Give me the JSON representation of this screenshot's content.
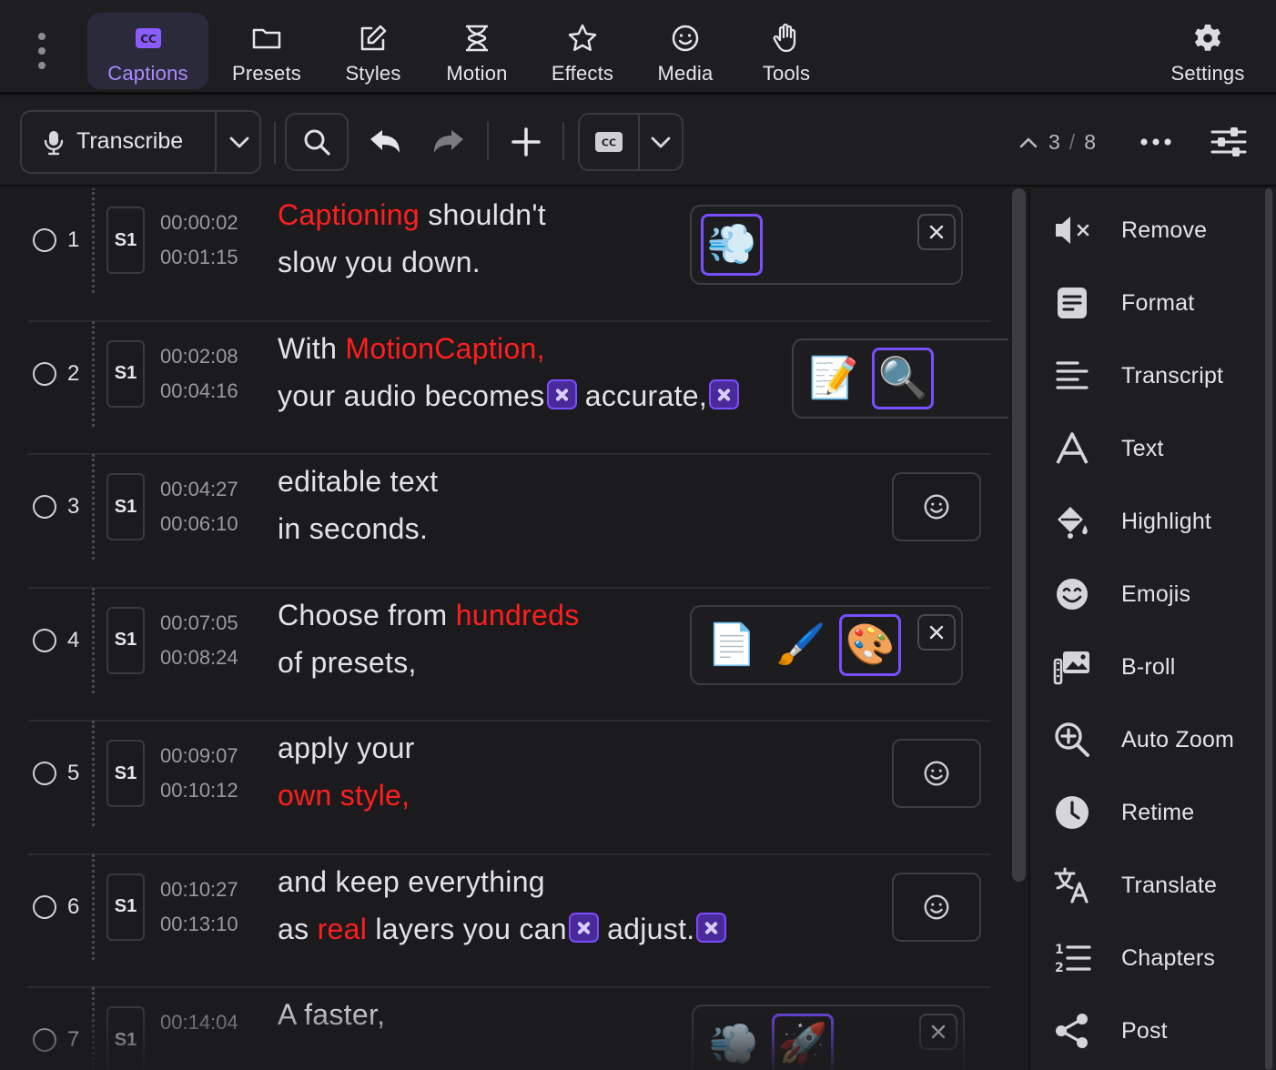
{
  "nav": {
    "items": [
      {
        "label": "Captions",
        "active": true
      },
      {
        "label": "Presets"
      },
      {
        "label": "Styles"
      },
      {
        "label": "Motion"
      },
      {
        "label": "Effects"
      },
      {
        "label": "Media"
      },
      {
        "label": "Tools"
      }
    ],
    "settings_label": "Settings",
    "captions_icon_text": "CC"
  },
  "toolbar": {
    "transcribe_label": "Transcribe",
    "cc_icon_text": "CC",
    "pager": {
      "current": "3",
      "separator": "/",
      "total": "8"
    }
  },
  "captions": [
    {
      "num": "1",
      "speaker": "S1",
      "start": "00:00:02",
      "end": "00:01:15",
      "line1": [
        {
          "t": "Captioning",
          "hl": true
        },
        {
          "t": " shouldn't"
        }
      ],
      "line2": [
        {
          "t": "slow you down."
        }
      ]
    },
    {
      "num": "2",
      "speaker": "S1",
      "start": "00:02:08",
      "end": "00:04:16",
      "line1": [
        {
          "t": "With "
        },
        {
          "t": "MotionCaption,",
          "hl": true
        }
      ],
      "line2": [
        {
          "t": "your audio becomes"
        },
        {
          "tag": true
        },
        {
          "t": " accurate,"
        },
        {
          "tag": true
        }
      ]
    },
    {
      "num": "3",
      "speaker": "S1",
      "start": "00:04:27",
      "end": "00:06:10",
      "line1": [
        {
          "t": "editable text"
        }
      ],
      "line2": [
        {
          "t": "in seconds."
        }
      ]
    },
    {
      "num": "4",
      "speaker": "S1",
      "start": "00:07:05",
      "end": "00:08:24",
      "line1": [
        {
          "t": "Choose from "
        },
        {
          "t": "hundreds",
          "hl": true
        }
      ],
      "line2": [
        {
          "t": "of presets,"
        }
      ]
    },
    {
      "num": "5",
      "speaker": "S1",
      "start": "00:09:07",
      "end": "00:10:12",
      "line1": [
        {
          "t": "apply your"
        }
      ],
      "line2": [
        {
          "t": "own style,",
          "hl": true
        }
      ]
    },
    {
      "num": "6",
      "speaker": "S1",
      "start": "00:10:27",
      "end": "00:13:10",
      "line1": [
        {
          "t": "and keep everything"
        }
      ],
      "line2": [
        {
          "t": "as "
        },
        {
          "t": "real",
          "hl": true
        },
        {
          "t": " layers you can"
        },
        {
          "tag": true
        },
        {
          "t": " adjust."
        },
        {
          "tag": true
        }
      ]
    },
    {
      "num": "7",
      "speaker": "S1",
      "start": "00:14:04",
      "end": "",
      "line1": [
        {
          "t": "A faster,"
        }
      ],
      "line2": []
    }
  ],
  "effects": {
    "row1": [
      "💨"
    ],
    "row2": [
      "📝",
      "🔍"
    ],
    "row4": [
      "📄",
      "🖌️",
      "🎨"
    ],
    "row7": [
      "💨",
      "🚀"
    ]
  },
  "side": {
    "items": [
      "Remove",
      "Format",
      "Transcript",
      "Text",
      "Highlight",
      "Emojis",
      "B-roll",
      "Auto Zoom",
      "Retime",
      "Translate",
      "Chapters",
      "Post"
    ]
  },
  "colors": {
    "accent": "#7a4dff",
    "highlight": "#ff1e1e",
    "background": "#1b1b1d",
    "panel": "#1e1e20"
  }
}
